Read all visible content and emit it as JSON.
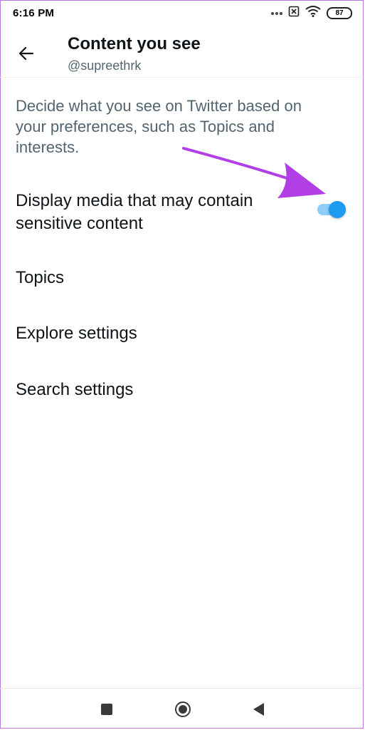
{
  "status_bar": {
    "time": "6:16 PM",
    "battery": "87",
    "icons": [
      "dots-icon",
      "sim-off-icon",
      "wifi-icon",
      "battery-icon"
    ]
  },
  "header": {
    "title": "Content you see",
    "subtitle": "@supreethrk",
    "back_icon": "back-arrow-icon"
  },
  "content": {
    "description": "Decide what you see on Twitter based on your preferences, such as Topics and interests.",
    "sensitive_media_label": "Display media that may contain sensitive content",
    "sensitive_media_enabled": true,
    "topics_label": "Topics",
    "explore_label": "Explore settings",
    "search_label": "Search settings"
  },
  "colors": {
    "accent": "#1d9bf0",
    "toggle_track": "#8ecdf8",
    "annotation_arrow": "#b23ee6",
    "secondary_text": "#536471"
  },
  "nav_bar": {
    "icons": [
      "recents-square-icon",
      "home-circle-icon",
      "back-triangle-icon"
    ]
  }
}
